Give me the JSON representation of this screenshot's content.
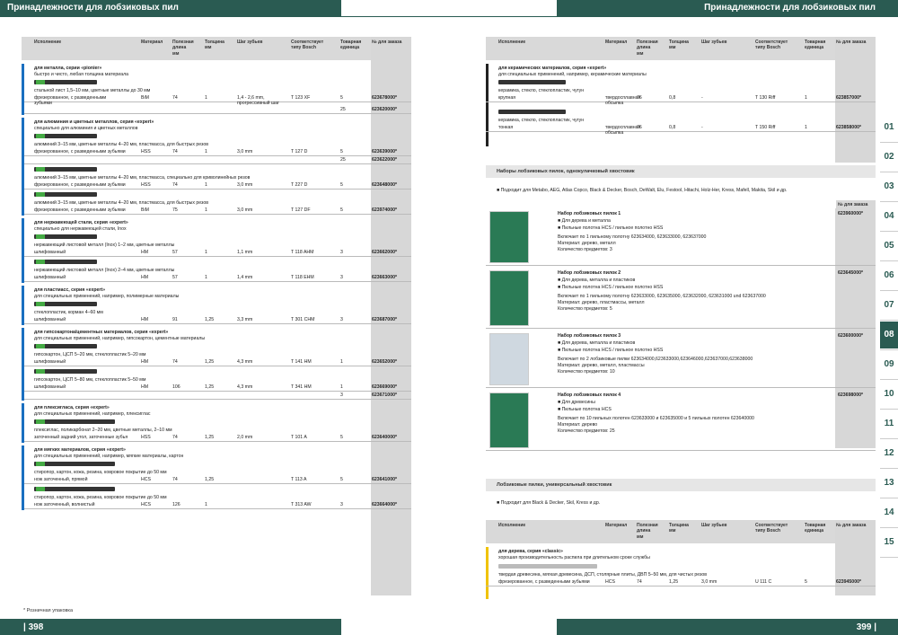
{
  "header": {
    "left_title": "Принадлежности для лобзиковых пил",
    "right_title": "Принадлежности для лобзиковых пил"
  },
  "footer": {
    "left_page": "| 398",
    "right_page": "399 |",
    "footnote": "* Розничная упаковка"
  },
  "left_table": {
    "headers": [
      "Исполнение",
      "Материал",
      "Полезная\nдлина\nмм",
      "Толщина\nмм",
      "Шаг зубьев",
      "Соответствует\nтипу Bosch",
      "Товарная\nединица",
      "№ для заказа"
    ],
    "sections": [
      {
        "title": "для металла, серии «pionier»",
        "desc": "быстро и чисто, любая толщина материала",
        "accent": "#1a6fc0",
        "items": [
          {
            "note": "стальной лист 1,5–10 мм, цветные металлы до 30 мм",
            "rows": [
              [
                "фрезерованное, с разведенными\nзубьями",
                "BiM",
                "74",
                "1",
                "1,4 - 2,6 mm,\nпрогрессивный шаг",
                "T 123 XF",
                "5",
                "623678000*"
              ],
              [
                "",
                "",
                "",
                "",
                "",
                "",
                "25",
                "623620000*"
              ]
            ]
          }
        ]
      },
      {
        "title": "для алюминия и цветных металлов, серия «expert»",
        "desc": "специально для алюминия и цветных металлов",
        "accent": "#1a6fc0",
        "items": [
          {
            "note": "алюминий 3–15 мм, цветные металлы 4–20 мм, пластмасса, для быстрых резов",
            "rows": [
              [
                "фрезерованное, с разведенными зубьями",
                "HSS",
                "74",
                "1",
                "3,0 mm",
                "T 127 D",
                "5",
                "623639000*"
              ],
              [
                "",
                "",
                "",
                "",
                "",
                "",
                "25",
                "623622000*"
              ]
            ]
          },
          {
            "note": "алюминий 3–15 мм, цветные металлы 4–20 мм, пластмасса, специально для криволинейных резов",
            "rows": [
              [
                "фрезерованное, с разведенными зубьями",
                "HSS",
                "74",
                "1",
                "3,0 mm",
                "T 227 D",
                "5",
                "623648000*"
              ]
            ]
          },
          {
            "note": "алюминий 3–15 мм, цветные металлы 4–20 мм, пластмасса, для быстрых резов",
            "rows": [
              [
                "фрезерованное, с разведенными зубьями",
                "BiM",
                "75",
                "1",
                "3,0 mm",
                "T 127 DF",
                "5",
                "623974000*"
              ]
            ]
          }
        ]
      },
      {
        "title": "для нержавеющей стали, серия «expert»",
        "desc": "специально для нержавеющей стали, Inox",
        "accent": "#1a6fc0",
        "items": [
          {
            "note": "нержавеющий листовой металл (Inox) 1–2 мм, цветные металлы",
            "rows": [
              [
                "шлифованный",
                "HM",
                "57",
                "1",
                "1,1 mm",
                "T 118 AHM",
                "3",
                "623662000*"
              ]
            ]
          },
          {
            "note": "нержавеющий листовой металл (Inox) 2–4 мм, цветные металлы",
            "rows": [
              [
                "шлифованный",
                "HM",
                "57",
                "1",
                "1,4 mm",
                "T 118 EHM",
                "3",
                "623663000*"
              ]
            ]
          }
        ]
      },
      {
        "title": "для пластмасс, серия «expert»",
        "desc": "для специальных применений, например, полимерные материалы",
        "accent": "#1a6fc0",
        "items": [
          {
            "note": "стеклопластик, корман 4–60 мм",
            "rows": [
              [
                "шлифованный",
                "HM",
                "91",
                "1,25",
                "3,3 mm",
                "T 301 CHM",
                "3",
                "623687000*"
              ]
            ]
          }
        ]
      },
      {
        "title": "для гипсокартона/цементных материалов, серия «expert»",
        "desc": "для специальных применений, например, гипсокартон, цементные материалы",
        "accent": "#1a6fc0",
        "items": [
          {
            "note": "гипсокартон, ЦСП 5–20 мм, стеклопластик 5–20 мм",
            "rows": [
              [
                "шлифованный",
                "HM",
                "74",
                "1,25",
                "4,3 mm",
                "T 141 HM",
                "1",
                "623652000*"
              ]
            ]
          },
          {
            "note": "гипсокартон, ЦСП 5–80 мм, стеклопластик 5–50 мм",
            "rows": [
              [
                "шлифованный",
                "HM",
                "106",
                "1,25",
                "4,3 mm",
                "T 341 HM",
                "1",
                "623669000*"
              ],
              [
                "",
                "",
                "",
                "",
                "",
                "",
                "3",
                "623671000*"
              ]
            ]
          }
        ]
      },
      {
        "title": "для плексигласа, серия «expert»",
        "desc": "для специальных применений, например, плексиглас",
        "accent": "#1a6fc0",
        "items": [
          {
            "note": "плексиглас, поликарбонат 2–20 мм, цветные металлы, 2–10 мм",
            "rows": [
              [
                "заточенный задний угол, заточенные зубья",
                "HSS",
                "74",
                "1,25",
                "2,0 mm",
                "T 101 A",
                "5",
                "623640000*"
              ]
            ]
          }
        ]
      },
      {
        "title": "для мягких материалов, серия «expert»",
        "desc": "для специальных применений, например, мягкие материалы, картон",
        "accent": "#1a6fc0",
        "items": [
          {
            "note": "стиропор, картон, кожа, резина, ковровое покрытие до 50 мм",
            "rows": [
              [
                "нож заточенный, прямой",
                "HCS",
                "74",
                "1,25",
                "",
                "T 113 A",
                "5",
                "623641000*"
              ]
            ]
          },
          {
            "note": "стиропор, картон, кожа, резина, ковровое покрытие до 50 мм",
            "rows": [
              [
                "нож заточенный, волнистый",
                "HCS",
                "126",
                "1",
                "",
                "T 313 AW",
                "3",
                "623664000*"
              ]
            ]
          }
        ]
      }
    ]
  },
  "right": {
    "headers": [
      "Исполнение",
      "Материал",
      "Полезная\nдлина\nмм",
      "Толщина\nмм",
      "Шаг зубьев",
      "Соответствует\nтипу Bosch",
      "Товарная\nединица",
      "№ для заказа"
    ],
    "ceramic": {
      "title": "для керамических материалов, серия «expert»",
      "desc": "для специальных применений, например, керамические материалы",
      "items": [
        {
          "note": "керамика, стекло, стеклопластик, чугун",
          "row": [
            "крупная",
            "твердосплавная\nобсыпка",
            "76",
            "0,8",
            "-",
            "T 130 Riff",
            "1",
            "623857000*"
          ]
        },
        {
          "note": "керамика, стекло, стеклопластик, чугун",
          "row": [
            "тонкая",
            "твердосплавная\nобсыпка",
            "76",
            "0,8",
            "-",
            "T 150 Riff",
            "1",
            "623858000*"
          ]
        }
      ]
    },
    "sets_band": "Наборы лобзиковых пилок, однокулачковый хвостовик",
    "sets_bullet": "Подходит для Metabo, AEG, Atlas Copco, Black & Decker, Bosch, DeWalt, Elu, Festool, Hitachi, Holz-Her, Kress, Mafell, Makita, Skil и др.",
    "sets_order_header": "№ для заказа",
    "sets": [
      {
        "title": "Набор лобзиковых пилок 1",
        "bullets": [
          "Для дерева и металла",
          "Пильные полотна HCS / пильное полотно HSS"
        ],
        "lines": [
          "Включает по 1 пильному полотну 623634000, 623633000, 623637000",
          "Материал: дерево, металл",
          "Количество предметов: 3"
        ],
        "order": "623960000*"
      },
      {
        "title": "Набор лобзиковых пилок 2",
        "bullets": [
          "Для дерева, металла и пластиков",
          "Пильные полотна HCS / пильное полотно HSS"
        ],
        "lines": [
          "Включает по 1 пильному полотну 623633000, 623635000, 623632000, 623631000 und 623637000",
          "Материал: дерево, пластмассы, металл",
          "Количество предметов: 5"
        ],
        "order": "623645000*"
      },
      {
        "title": "Набор лобзиковых пилок 3",
        "bullets": [
          "Для дерева, металла и пластиков",
          "Пильные полотна HCS / пильное полотно HSS"
        ],
        "lines": [
          "Включает по 2 лобзиковые пилки 623634000,623633000,623646000,623637000,623638000",
          "Материал: дерево, металл, пластмассы",
          "Количество предметов: 10"
        ],
        "order": "623600000*"
      },
      {
        "title": "Набор лобзиковых пилок 4",
        "bullets": [
          "Для древесины",
          "Пильные полотна HCS"
        ],
        "lines": [
          "Включает по 10 пильных полотен 623633000 и 623635000 и 5 пильных полотен 623640000",
          "Материал: дерево",
          "Количество предметов: 25"
        ],
        "order": "623698000*"
      }
    ],
    "universal_band": "Лобзиковые пилки, универсальный хвостовик",
    "universal_bullet": "Подходит для Black & Decker, Skil, Kress и др.",
    "wood": {
      "title": "для дерева, серия «classic»",
      "desc": "хорошая производительность распила при длительном сроке службы",
      "note": "твердая древесина, мягкая древесина, ДСП, столярные плиты, ДВП 5–50 мм, для чистых резов",
      "row": [
        "фрезерованное, с разведенными зубьями",
        "HCS",
        "74",
        "1,25",
        "3,0 mm",
        "U 111 C",
        "5",
        "623945000*"
      ]
    }
  },
  "tabs": [
    "01",
    "02",
    "03",
    "04",
    "05",
    "06",
    "07",
    "08",
    "09",
    "10",
    "11",
    "12",
    "13",
    "14",
    "15"
  ],
  "active_tab": "08"
}
